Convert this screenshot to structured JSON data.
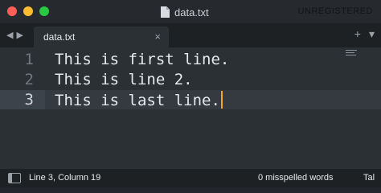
{
  "window": {
    "title": "data.txt",
    "license_status": "UNREGISTERED",
    "traffic_lights": {
      "close": "#ff5f57",
      "minimize": "#febc2e",
      "zoom": "#28c840"
    }
  },
  "tabbar": {
    "back_glyph": "◀",
    "forward_glyph": "▶",
    "tabs": [
      {
        "label": "data.txt",
        "close_glyph": "×"
      }
    ],
    "add_glyph": "+",
    "menu_glyph": "▾"
  },
  "editor": {
    "lines": [
      {
        "number": "1",
        "text": "This is first line."
      },
      {
        "number": "2",
        "text": "This is line 2."
      },
      {
        "number": "3",
        "text": "This is last line."
      }
    ],
    "current_line": 3,
    "cursor_color": "#f5a623"
  },
  "statusbar": {
    "position": "Line 3, Column 19",
    "spellcheck": "0 misspelled words",
    "indent": "Tal"
  }
}
